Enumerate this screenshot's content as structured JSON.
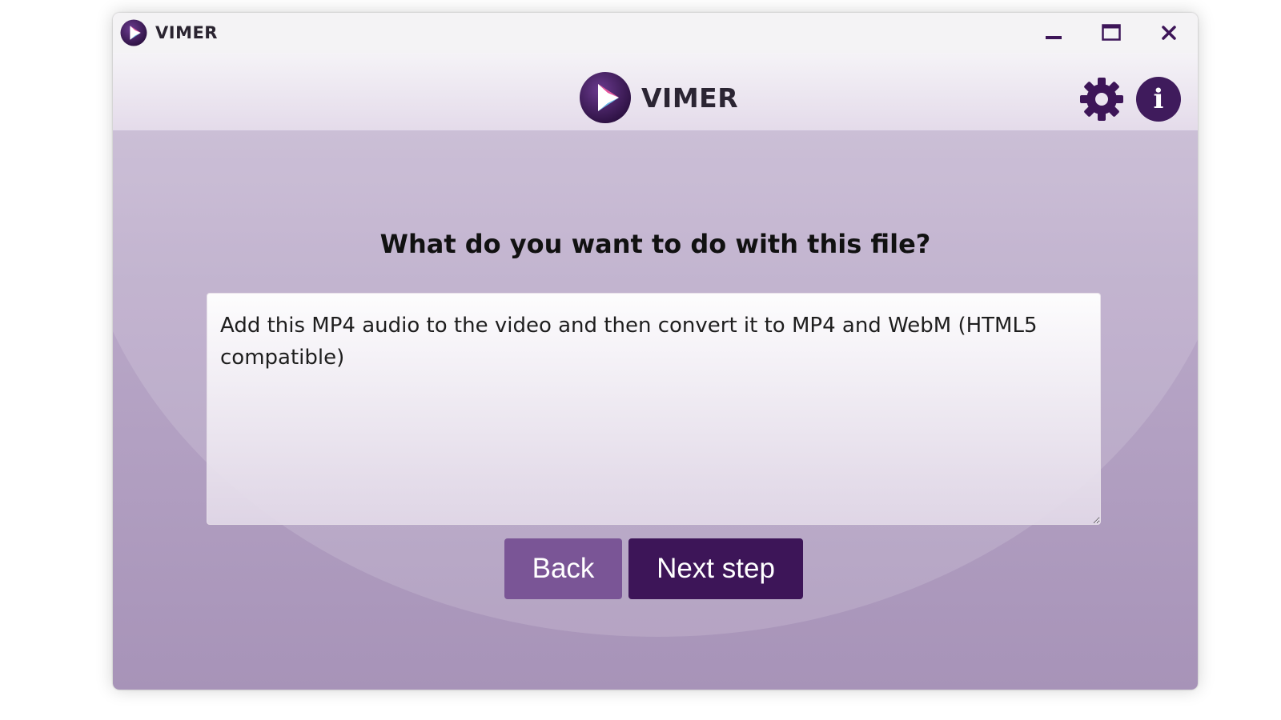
{
  "window": {
    "title": "VIMER",
    "controls": [
      "minimize-icon",
      "maximize-icon",
      "close-icon"
    ]
  },
  "header": {
    "brand": "VIMER",
    "icons": [
      "gear-icon",
      "info-icon"
    ],
    "info_glyph": "i"
  },
  "main": {
    "question": "What do you want to do with this file?",
    "prompt_value": "Add this MP4 audio to the video and then convert it to MP4 and WebM (HTML5 compatible)",
    "back_label": "Back",
    "next_label": "Next step"
  },
  "colors": {
    "accent_dark": "#3d1558",
    "accent_light": "#7a5596",
    "background": "#b9a8c8"
  }
}
